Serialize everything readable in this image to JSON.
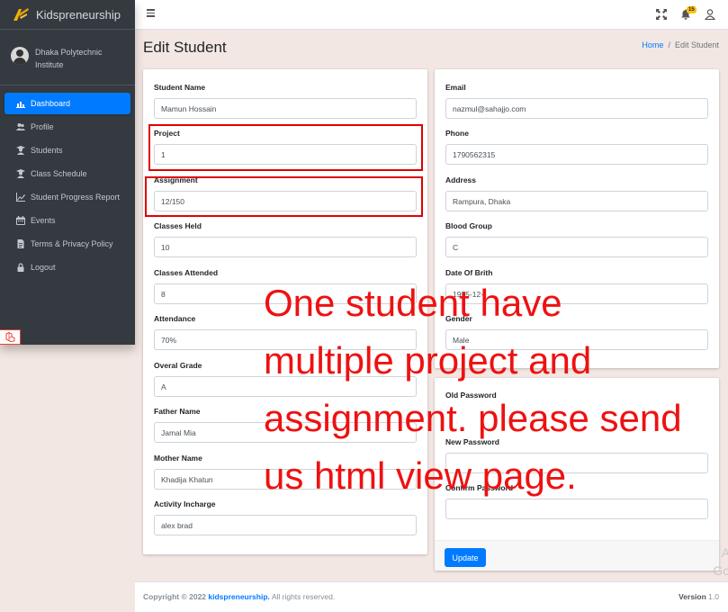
{
  "brand": {
    "name": "Kidspreneurship"
  },
  "user": {
    "institute": "Dhaka Polytechnic Institute"
  },
  "sidebar": {
    "items": [
      {
        "label": "Dashboard",
        "icon": "chart-icon"
      },
      {
        "label": "Profile",
        "icon": "users-icon"
      },
      {
        "label": "Students",
        "icon": "student-icon"
      },
      {
        "label": "Class Schedule",
        "icon": "teacher-icon"
      },
      {
        "label": "Student Progress Report",
        "icon": "chart-line-icon"
      },
      {
        "label": "Events",
        "icon": "calendar-icon"
      },
      {
        "label": "Terms & Privacy Policy",
        "icon": "document-icon"
      },
      {
        "label": "Logout",
        "icon": "lock-icon"
      }
    ]
  },
  "topbar": {
    "notifications_count": "15"
  },
  "header": {
    "title": "Edit Student"
  },
  "breadcrumb": {
    "home": "Home",
    "current": "Edit Student"
  },
  "form_left": {
    "student_name": {
      "label": "Student Name",
      "value": "Mamun Hossain"
    },
    "project": {
      "label": "Project",
      "value": "1"
    },
    "assignment": {
      "label": "Assignment",
      "value": "12/150"
    },
    "classes_held": {
      "label": "Classes Held",
      "value": "10"
    },
    "classes_attended": {
      "label": "Classes Attended",
      "value": "8"
    },
    "attendance": {
      "label": "Attendance",
      "value": "70%"
    },
    "overall_grade": {
      "label": "Overal Grade",
      "value": "A"
    },
    "father_name": {
      "label": "Father Name",
      "value": "Jamal Mia"
    },
    "mother_name": {
      "label": "Mother Name",
      "value": "Khadija Khatun"
    },
    "activity_incharge": {
      "label": "Activity Incharge",
      "value": "alex brad"
    }
  },
  "form_right": {
    "email": {
      "label": "Email",
      "value": "nazmul@sahajjo.com"
    },
    "phone": {
      "label": "Phone",
      "value": "1790562315"
    },
    "address": {
      "label": "Address",
      "value": "Rampura, Dhaka"
    },
    "blood_group": {
      "label": "Blood Group",
      "value": "C"
    },
    "dob": {
      "label": "Date Of Brith",
      "value": "1995-12-"
    },
    "gender": {
      "label": "Gender",
      "value": "Male"
    }
  },
  "form_password": {
    "old_password": {
      "label": "Old Password",
      "value": ""
    },
    "new_password": {
      "label": "New Password",
      "value": ""
    },
    "confirm_password": {
      "label": "Confirm Password",
      "value": ""
    },
    "update_label": "Update"
  },
  "annotation": {
    "text": "One student have\nmultiple project and\nassignment. please send\nus html view page."
  },
  "footer": {
    "copyright": "Copyright © 2022",
    "brand_link": "kidspreneurship.",
    "rights": "All rights reserved.",
    "version_label": "Version",
    "version": "1.0"
  },
  "watermark": {
    "line1": "A",
    "line2": "Go"
  },
  "colors": {
    "primary": "#007bff",
    "sidebar": "#343a40",
    "annotation": "#ee1111",
    "content_bg": "#f3e7e3"
  }
}
